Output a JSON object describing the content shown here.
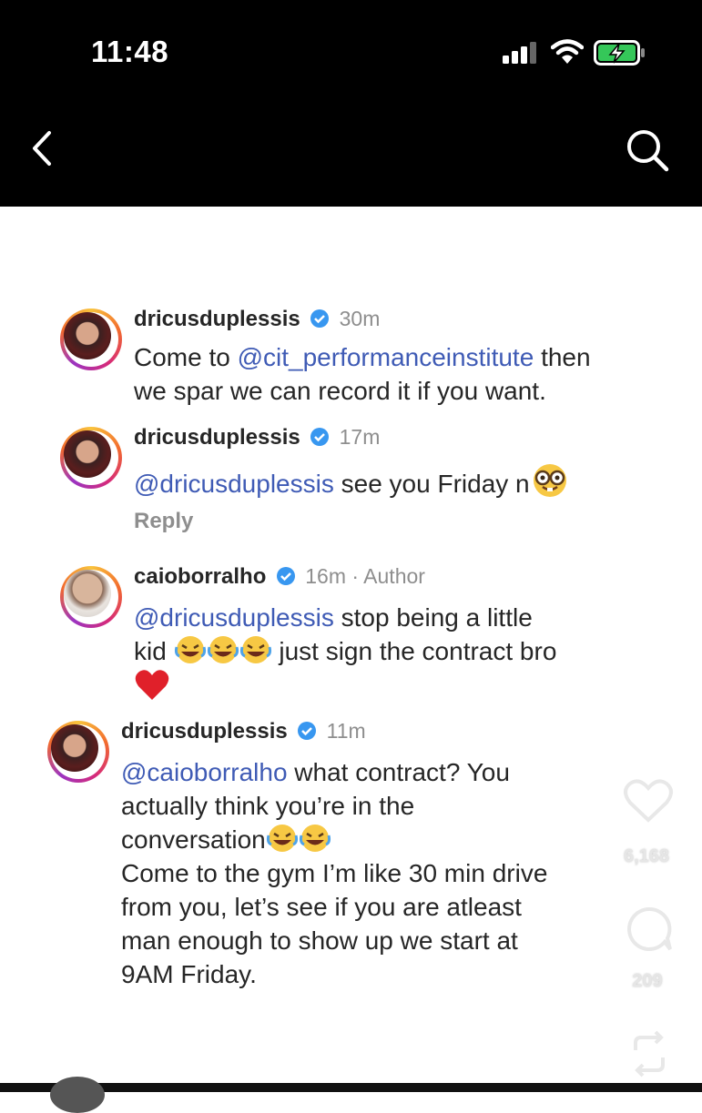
{
  "status_bar": {
    "time": "11:48"
  },
  "comments": [
    {
      "username": "dricusduplessis",
      "time": "30m",
      "text_before": "Come to ",
      "mention": "@cit_performanceinstitute",
      "text_after": " then",
      "text_line2": "we spar we can record it if you want."
    },
    {
      "username": "dricusduplessis",
      "time": "17m",
      "mention": "@dricusduplessis",
      "text_after": " see you Friday n",
      "reply_label": "Reply"
    },
    {
      "username": "caioborralho",
      "time": "16m · Author",
      "mention": "@dricusduplessis",
      "text_after": " stop being a little",
      "line2_before": "kid ",
      "line2_after": " just sign the contract bro"
    },
    {
      "username": "dricusduplessis",
      "time": "11m",
      "mention": "@caioborralho",
      "text_after": " what contract? You",
      "line2": "actually think you’re in the",
      "line3": "conversation",
      "line4": "Come to the gym I’m like 30 min drive",
      "line5": "from you, let’s see if you are atleast",
      "line6": "man enough to show up we start at",
      "line7": "9AM Friday."
    }
  ],
  "sidebar": {
    "likes": "6,168",
    "comments": "209"
  },
  "icons": [
    "back-arrow-icon",
    "search-icon",
    "signal-icon",
    "wifi-icon",
    "battery-charging-icon",
    "verified-badge-icon",
    "heart-icon",
    "comment-icon",
    "repost-icon",
    "nerd-face-emoji",
    "laughing-emoji",
    "red-heart-emoji"
  ]
}
